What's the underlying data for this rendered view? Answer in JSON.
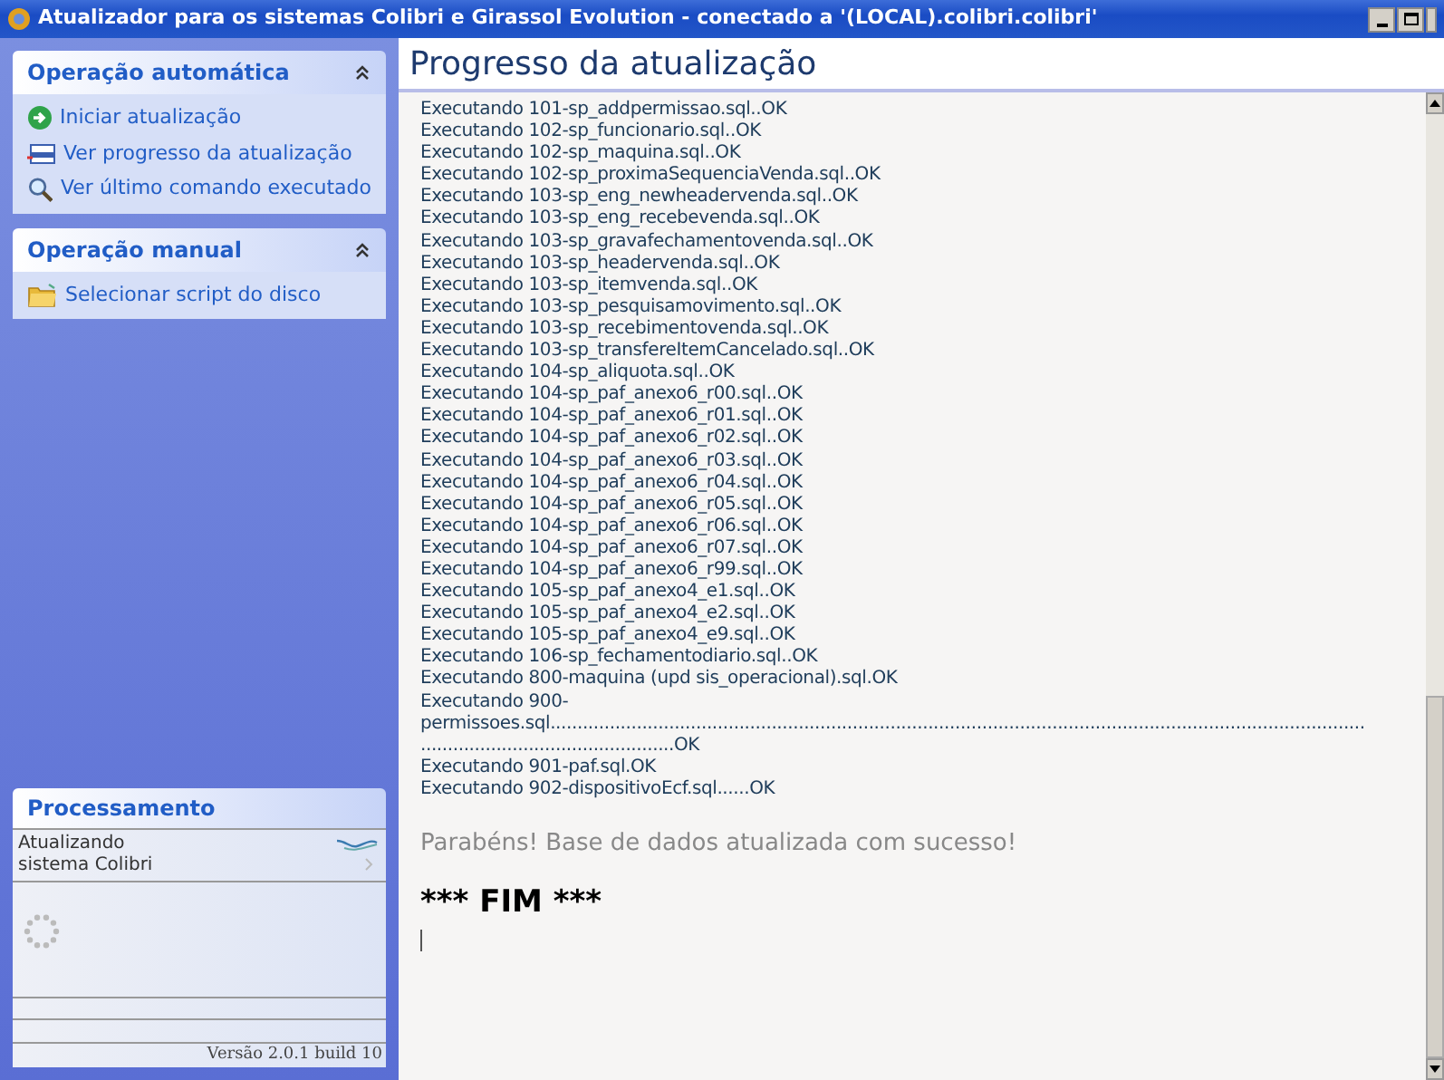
{
  "window": {
    "title": "Atualizador para os sistemas Colibri e Girassol Evolution - conectado a '(LOCAL).colibri.colibri'"
  },
  "sidebar": {
    "panels": [
      {
        "title": "Operação automática",
        "expanded": true,
        "items": [
          {
            "label": "Iniciar atualização",
            "kind": "start"
          },
          {
            "label": "Ver progresso da atualização",
            "kind": "progress"
          },
          {
            "label": "Ver último comando executado",
            "kind": "search"
          }
        ]
      },
      {
        "title": "Operação manual",
        "expanded": true,
        "items": [
          {
            "label": "Selecionar script do disco",
            "kind": "folder"
          }
        ]
      }
    ],
    "processing": {
      "title": "Processamento",
      "status_lines": [
        "Atualizando",
        "sistema Colibri"
      ],
      "version": "Versão 2.0.1 build 10"
    }
  },
  "main": {
    "title": "Progresso da atualização",
    "log": [
      "Executando 101-sp_addpermissao.sql..OK",
      "Executando 102-sp_funcionario.sql..OK",
      "Executando 102-sp_maquina.sql..OK",
      "Executando 102-sp_proximaSequenciaVenda.sql..OK",
      "Executando 103-sp_eng_newheadervenda.sql..OK",
      "Executando 103-sp_eng_recebevenda.sql..OK",
      "Executando 103-sp_gravafechamentovenda.sql..OK",
      "Executando 103-sp_headervenda.sql..OK",
      "Executando 103-sp_itemvenda.sql..OK",
      "Executando 103-sp_pesquisamovimento.sql..OK",
      "Executando 103-sp_recebimentovenda.sql..OK",
      "Executando 103-sp_transfereItemCancelado.sql..OK",
      "Executando 104-sp_aliquota.sql..OK",
      "Executando 104-sp_paf_anexo6_r00.sql..OK",
      "Executando 104-sp_paf_anexo6_r01.sql..OK",
      "Executando 104-sp_paf_anexo6_r02.sql..OK",
      "Executando 104-sp_paf_anexo6_r03.sql..OK",
      "Executando 104-sp_paf_anexo6_r04.sql..OK",
      "Executando 104-sp_paf_anexo6_r05.sql..OK",
      "Executando 104-sp_paf_anexo6_r06.sql..OK",
      "Executando 104-sp_paf_anexo6_r07.sql..OK",
      "Executando 104-sp_paf_anexo6_r99.sql..OK",
      "Executando 105-sp_paf_anexo4_e1.sql..OK",
      "Executando 105-sp_paf_anexo4_e2.sql..OK",
      "Executando 105-sp_paf_anexo4_e9.sql..OK",
      "Executando 106-sp_fechamentodiario.sql..OK",
      "Executando 800-maquina (upd sis_operacional).sql.OK",
      "Executando 900-",
      "permissoes.sql.......................................................................................................................................................",
      "...............................................OK",
      "Executando 901-paf.sql.OK",
      "Executando 902-dispositivoEcf.sql......OK"
    ],
    "success": "Parabéns! Base de dados atualizada com sucesso!",
    "end": "*** FIM ***"
  }
}
